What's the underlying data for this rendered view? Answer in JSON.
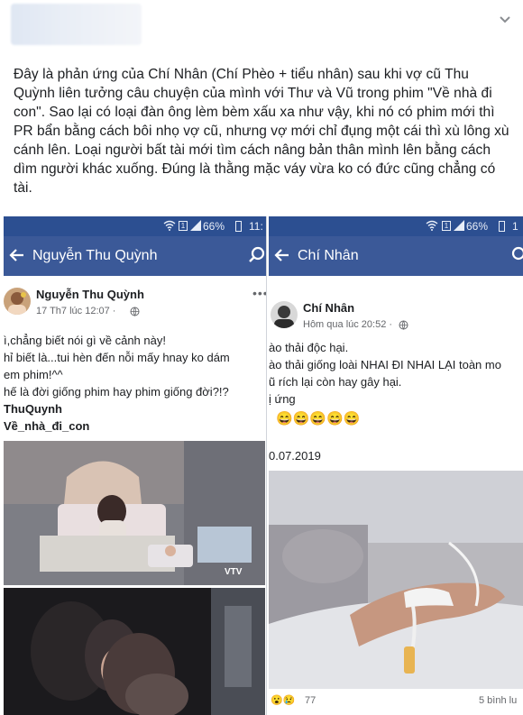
{
  "post": {
    "menu_icon": "chevron-down-icon",
    "text": "Đây là phản ứng của Chí Nhân (Chí Phèo + tiểu nhân) sau khi vợ cũ Thu Quỳnh liên tưởng câu chuyện của mình với Thư và Vũ trong phim \"Về nhà đi con\". Sao lại có loại đàn ông lèm bèm xấu xa như vậy, khi nó có phim mới thì PR bẩn bằng cách bôi nhọ vợ cũ, nhưng vợ mới chỉ đụng một cái thì xù lông xù cánh lên. Loại người bất tài mới tìm cách nâng bản thân mình lên bằng cách dìm người khác xuống. Đúng là thằng mặc váy vừa ko có đức cũng chẳng có tài."
  },
  "left": {
    "status": {
      "sim": "1",
      "battery": "66%",
      "time": "11:"
    },
    "app_title": "Nguyễn Thu Quỳnh",
    "author": "Nguyễn Thu Quỳnh",
    "meta": "17 Th7 lúc 12:07 ·",
    "lines": [
      "ì,chẳng biết nói gì về cảnh này!",
      "hỉ biết là...tui hèn đến nỗi mấy hnay ko dám",
      "em phim!^^",
      "hế là đời giống phim hay phim giống đời?!?",
      "ThuQuynh",
      "Về_nhà_đi_con"
    ],
    "logo": "VTV"
  },
  "right": {
    "status": {
      "sim": "1",
      "battery": "66%",
      "time": "1"
    },
    "app_title": "Chí Nhân",
    "author": "Chí Nhân",
    "meta": "Hôm qua lúc 20:52 ·",
    "lines": [
      "ào thải độc hại.",
      "ào thải giống loài NHAI ĐI NHAI LẠI toàn mo",
      "ũ rích lại còn hay gây  hại.",
      "ị ứng"
    ],
    "emojis": "😄😄😄😄😄",
    "date": "0.07.2019",
    "reactions": "77",
    "comments": "5 bình lu"
  }
}
